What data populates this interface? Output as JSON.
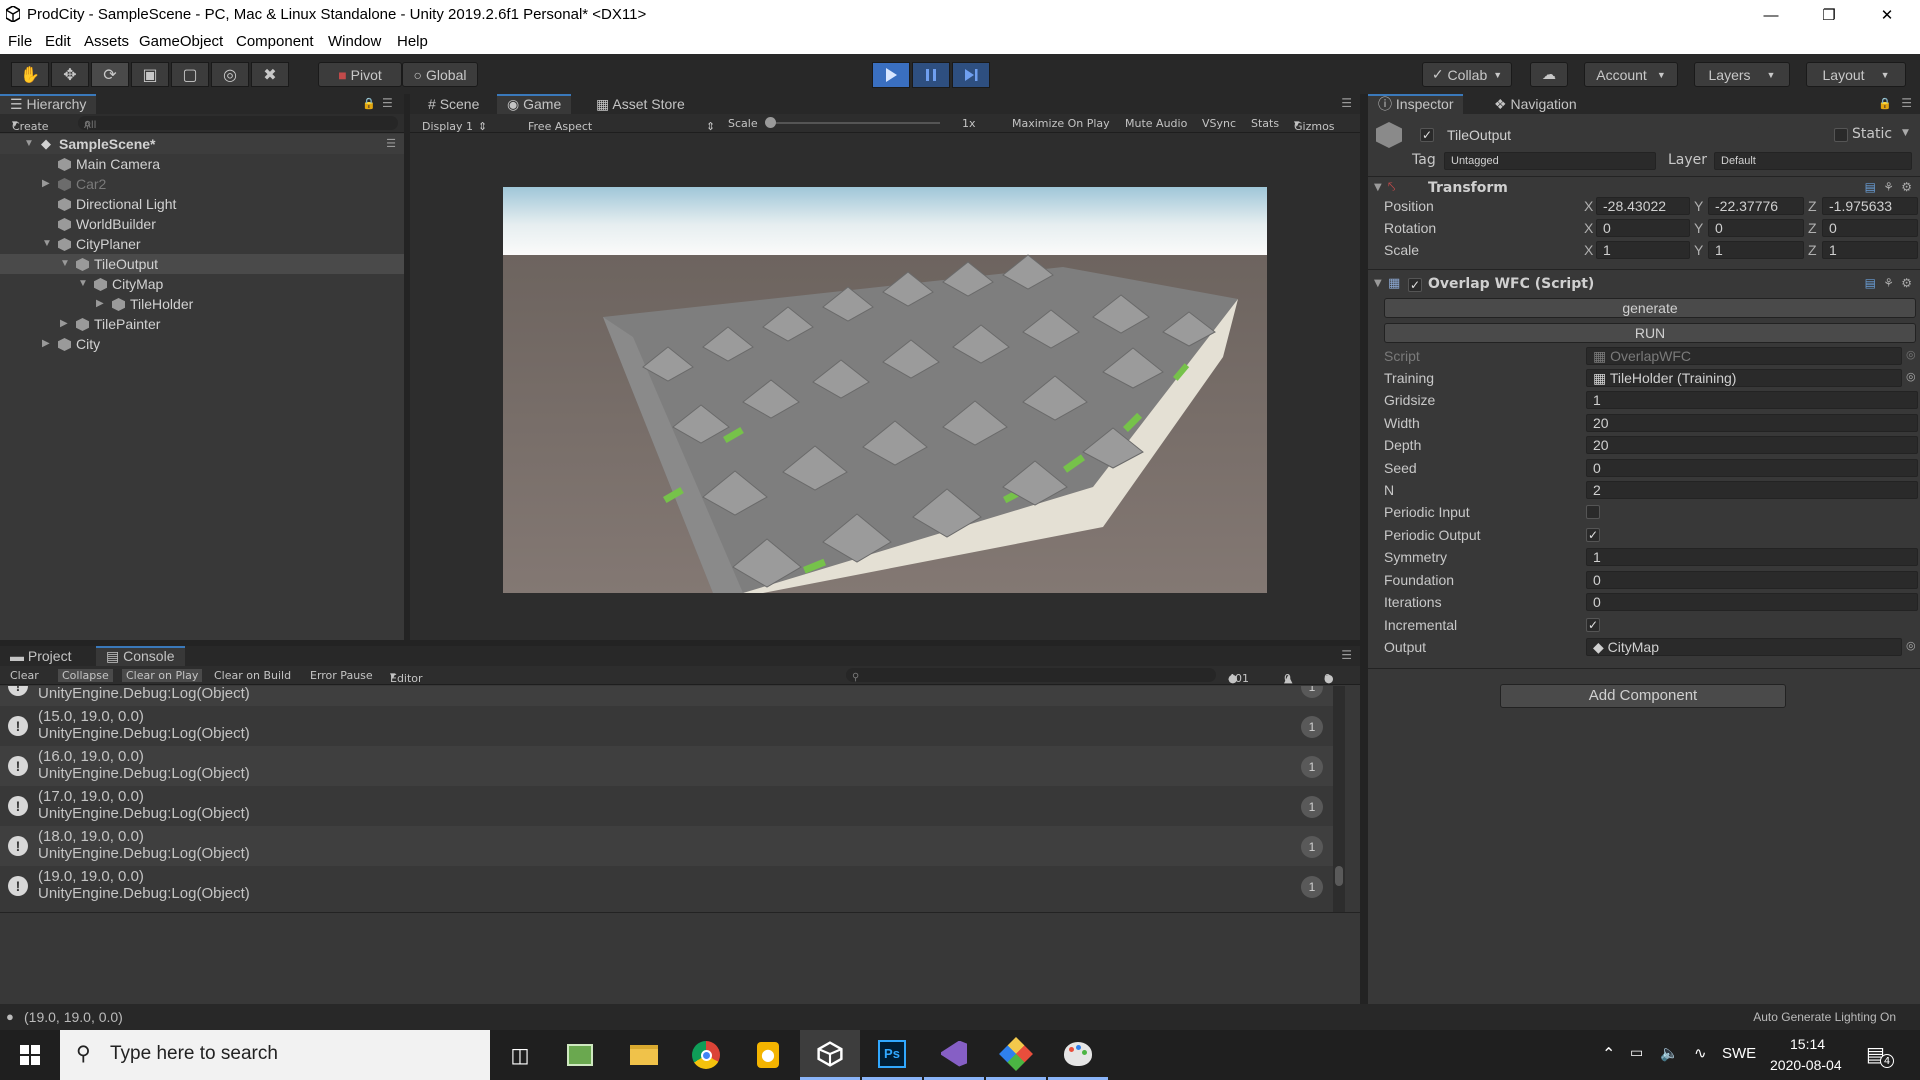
{
  "window": {
    "title": "ProdCity - SampleScene - PC, Mac & Linux Standalone - Unity 2019.2.6f1 Personal* <DX11>"
  },
  "menu": [
    "File",
    "Edit",
    "Assets",
    "GameObject",
    "Component",
    "Window",
    "Help"
  ],
  "toolbar": {
    "pivot": "Pivot",
    "global": "Global",
    "collab": "Collab",
    "account": "Account",
    "layers": "Layers",
    "layout": "Layout"
  },
  "hierarchy": {
    "tab": "Hierarchy",
    "create": "Create",
    "search_placeholder": "All",
    "scene": "SampleScene*",
    "items": [
      "Main Camera",
      "Car2",
      "Directional Light",
      "WorldBuilder",
      "CityPlaner",
      "TileOutput",
      "CityMap",
      "TileHolder",
      "TilePainter",
      "City"
    ]
  },
  "game": {
    "tabs": [
      "Scene",
      "Game",
      "Asset Store"
    ],
    "display": "Display 1",
    "aspect": "Free Aspect",
    "scale_label": "Scale",
    "scale_value": "1x",
    "options": [
      "Maximize On Play",
      "Mute Audio",
      "VSync",
      "Stats",
      "Gizmos"
    ]
  },
  "inspector": {
    "tabs": [
      "Inspector",
      "Navigation"
    ],
    "object_name": "TileOutput",
    "static_label": "Static",
    "tag_label": "Tag",
    "tag_value": "Untagged",
    "layer_label": "Layer",
    "layer_value": "Default",
    "transform": {
      "title": "Transform",
      "position_label": "Position",
      "rotation_label": "Rotation",
      "scale_label": "Scale",
      "position": [
        "-28.43022",
        "-22.37776",
        "-1.975633"
      ],
      "rotation": [
        "0",
        "0",
        "0"
      ],
      "scale": [
        "1",
        "1",
        "1"
      ]
    },
    "script": {
      "title": "Overlap WFC (Script)",
      "generate": "generate",
      "run": "RUN",
      "fields": [
        {
          "label": "Script",
          "value": "OverlapWFC"
        },
        {
          "label": "Training",
          "value": "TileHolder (Training)"
        },
        {
          "label": "Gridsize",
          "value": "1"
        },
        {
          "label": "Width",
          "value": "20"
        },
        {
          "label": "Depth",
          "value": "20"
        },
        {
          "label": "Seed",
          "value": "0"
        },
        {
          "label": "N",
          "value": "2"
        },
        {
          "label": "Periodic Input",
          "value": ""
        },
        {
          "label": "Periodic Output",
          "value": "✓"
        },
        {
          "label": "Symmetry",
          "value": "1"
        },
        {
          "label": "Foundation",
          "value": "0"
        },
        {
          "label": "Iterations",
          "value": "0"
        },
        {
          "label": "Incremental",
          "value": "✓"
        },
        {
          "label": "Output",
          "value": "CityMap"
        }
      ]
    },
    "add_component": "Add Component"
  },
  "console": {
    "tabs": [
      "Project",
      "Console"
    ],
    "buttons": [
      "Clear",
      "Collapse",
      "Clear on Play",
      "Clear on Build",
      "Error Pause",
      "Editor"
    ],
    "counts": {
      "logs": "401",
      "warnings": "0",
      "errors": "0"
    },
    "partial_line": "UnityEngine.Debug:Log(Object)",
    "entries": [
      {
        "msg": "(15.0, 19.0, 0.0)",
        "trace": "UnityEngine.Debug:Log(Object)",
        "count": "1"
      },
      {
        "msg": "(16.0, 19.0, 0.0)",
        "trace": "UnityEngine.Debug:Log(Object)",
        "count": "1"
      },
      {
        "msg": "(17.0, 19.0, 0.0)",
        "trace": "UnityEngine.Debug:Log(Object)",
        "count": "1"
      },
      {
        "msg": "(18.0, 19.0, 0.0)",
        "trace": "UnityEngine.Debug:Log(Object)",
        "count": "1"
      },
      {
        "msg": "(19.0, 19.0, 0.0)",
        "trace": "UnityEngine.Debug:Log(Object)",
        "count": "1"
      }
    ]
  },
  "statusbar": {
    "message": "(19.0, 19.0, 0.0)",
    "right": "Auto Generate Lighting On"
  },
  "taskbar": {
    "search_placeholder": "Type here to search",
    "lang": "SWE",
    "time": "15:14",
    "date": "2020-08-04",
    "notif_count": "4"
  },
  "colors": {
    "accent": "#3a79bb",
    "play_blue": "#3a6fc0",
    "panel": "#383838"
  }
}
